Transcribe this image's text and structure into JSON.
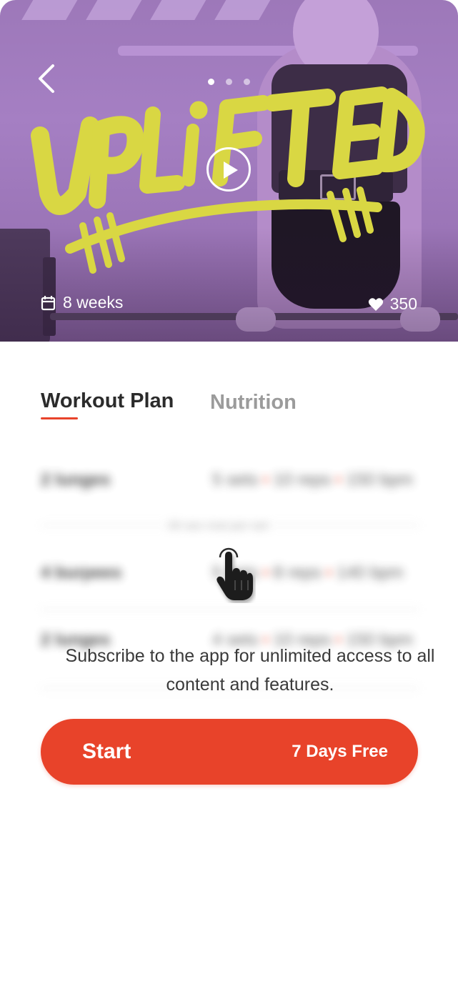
{
  "hero": {
    "title_art": "UPLIFTED",
    "duration": "8 weeks",
    "likes": "350",
    "carousel": {
      "count": 3,
      "active_index": 0
    }
  },
  "tabs": [
    {
      "label": "Workout Plan",
      "active": true
    },
    {
      "label": "Nutrition",
      "active": false
    }
  ],
  "locked_preview": {
    "rows": [
      {
        "name": "2 lunges",
        "detail": [
          "5 sets",
          "10 reps",
          "150 bpm"
        ]
      },
      {
        "name": "4 burpees",
        "detail": [
          "5 sets",
          "8 reps",
          "140 bpm"
        ]
      },
      {
        "name": "2 lunges",
        "detail": [
          "4 sets",
          "10 reps",
          "150 bpm"
        ]
      }
    ],
    "rest_note": "30 sec rest per set"
  },
  "promo_text": "Subscribe to the app for unlimited access to all content and features.",
  "cta": {
    "label": "Start",
    "offer": "7 Days Free"
  },
  "colors": {
    "accent": "#e8432a",
    "hero_purple": "#a57fc3",
    "title_yellow": "#d9d743"
  }
}
